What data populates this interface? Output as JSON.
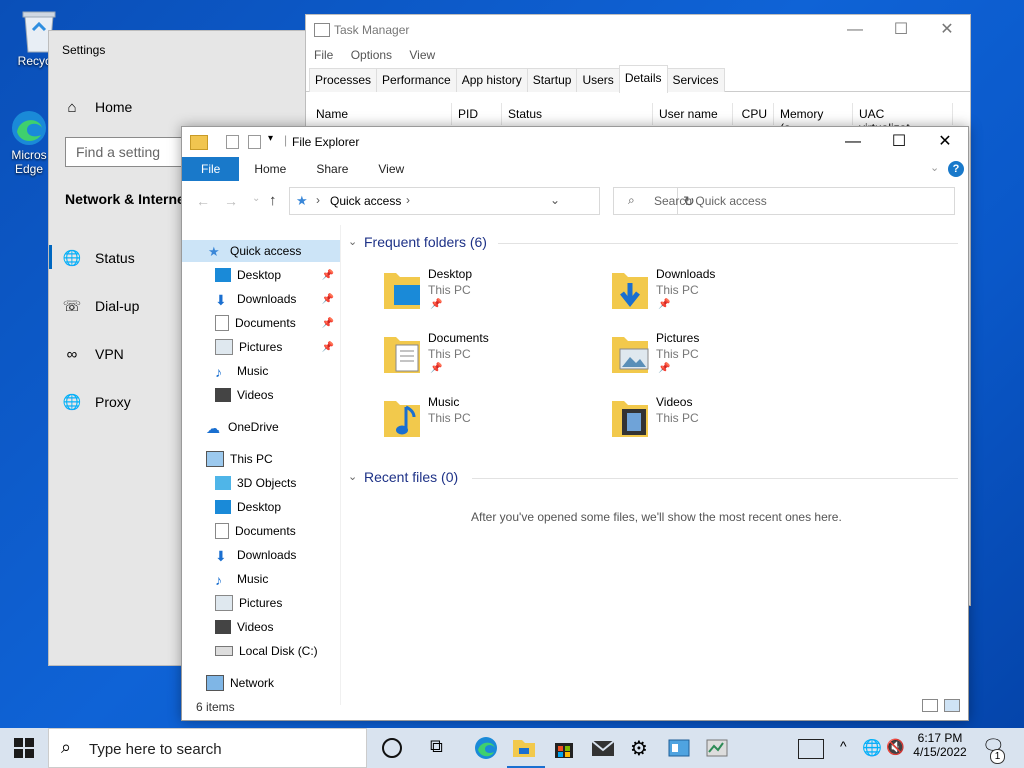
{
  "desktop": {
    "recycle_label": "Recycle",
    "edge_label_1": "Micros",
    "edge_label_2": "Edge"
  },
  "settings": {
    "title": "Settings",
    "home": "Home",
    "search_placeholder": "Find a setting",
    "section": "Network & Interne",
    "items": [
      "Status",
      "Dial-up",
      "VPN",
      "Proxy"
    ]
  },
  "task_manager": {
    "title": "Task Manager",
    "menu": [
      "File",
      "Options",
      "View"
    ],
    "tabs": [
      "Processes",
      "Performance",
      "App history",
      "Startup",
      "Users",
      "Details",
      "Services"
    ],
    "active_tab": "Details",
    "columns": [
      "Name",
      "PID",
      "Status",
      "User name",
      "CPU",
      "Memory (a...",
      "UAC virtualizat..."
    ]
  },
  "explorer": {
    "title": "File Explorer",
    "ribbon_tabs": [
      "File",
      "Home",
      "Share",
      "View"
    ],
    "address": "Quick access",
    "search_placeholder": "Search Quick access",
    "nav": {
      "quick_access": "Quick access",
      "qa_items": [
        "Desktop",
        "Downloads",
        "Documents",
        "Pictures",
        "Music",
        "Videos"
      ],
      "onedrive": "OneDrive",
      "this_pc": "This PC",
      "pc_items": [
        "3D Objects",
        "Desktop",
        "Documents",
        "Downloads",
        "Music",
        "Pictures",
        "Videos",
        "Local Disk (C:)"
      ],
      "network": "Network"
    },
    "frequent_header": "Frequent folders (6)",
    "folders": [
      {
        "name": "Desktop",
        "location": "This PC"
      },
      {
        "name": "Downloads",
        "location": "This PC"
      },
      {
        "name": "Documents",
        "location": "This PC"
      },
      {
        "name": "Pictures",
        "location": "This PC"
      },
      {
        "name": "Music",
        "location": "This PC"
      },
      {
        "name": "Videos",
        "location": "This PC"
      }
    ],
    "recent_header": "Recent files (0)",
    "recent_empty": "After you've opened some files, we'll show the most recent ones here.",
    "status": "6 items"
  },
  "taskbar": {
    "search_placeholder": "Type here to search",
    "time": "6:17 PM",
    "date": "4/15/2022",
    "notification_count": "1"
  }
}
